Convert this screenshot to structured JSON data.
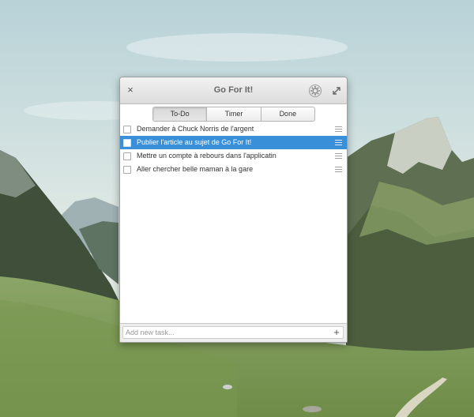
{
  "window": {
    "title": "Go For It!",
    "close_icon": "×",
    "settings_icon": "gear-icon",
    "maximize_icon": "maximize-icon"
  },
  "tabs": [
    {
      "label": "To-Do",
      "active": true
    },
    {
      "label": "Timer",
      "active": false
    },
    {
      "label": "Done",
      "active": false
    }
  ],
  "tasks": [
    {
      "text": "Demander à Chuck Norris de l'argent",
      "done": false,
      "selected": false
    },
    {
      "text": "Publier l'article au sujet de Go For It!",
      "done": false,
      "selected": true
    },
    {
      "text": "Mettre un compte à rebours dans l'applicatin",
      "done": false,
      "selected": false
    },
    {
      "text": "Aller chercher belle maman à la gare",
      "done": false,
      "selected": false
    }
  ],
  "footer": {
    "new_task_placeholder": "Add new task...",
    "new_task_value": "",
    "add_icon": "+"
  },
  "colors": {
    "selection": "#3a8fd9",
    "titlebar": "#e6e6e6"
  }
}
